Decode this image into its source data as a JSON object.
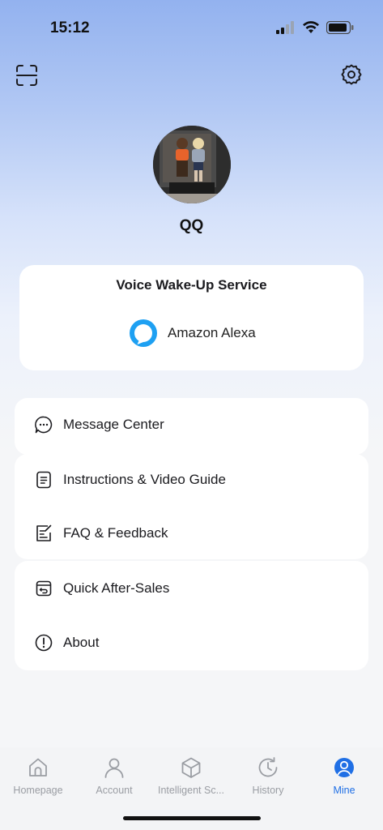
{
  "status_bar": {
    "time": "15:12"
  },
  "profile": {
    "name": "QQ"
  },
  "voice_card": {
    "title": "Voice Wake-Up Service",
    "service_label": "Amazon Alexa"
  },
  "menu": {
    "message_center": "Message Center",
    "instructions": "Instructions & Video Guide",
    "faq": "FAQ & Feedback",
    "after_sales": "Quick After-Sales",
    "about": "About"
  },
  "tabs": [
    {
      "label": "Homepage",
      "icon": "home-icon",
      "active": false
    },
    {
      "label": "Account",
      "icon": "person-icon",
      "active": false
    },
    {
      "label": "Intelligent Sc...",
      "icon": "cube-icon",
      "active": false
    },
    {
      "label": "History",
      "icon": "history-icon",
      "active": false
    },
    {
      "label": "Mine",
      "icon": "user-circle-icon",
      "active": true
    }
  ],
  "colors": {
    "accent": "#1f6fe5",
    "alexa": "#1ea0f2",
    "inactive": "#9a9da3"
  }
}
